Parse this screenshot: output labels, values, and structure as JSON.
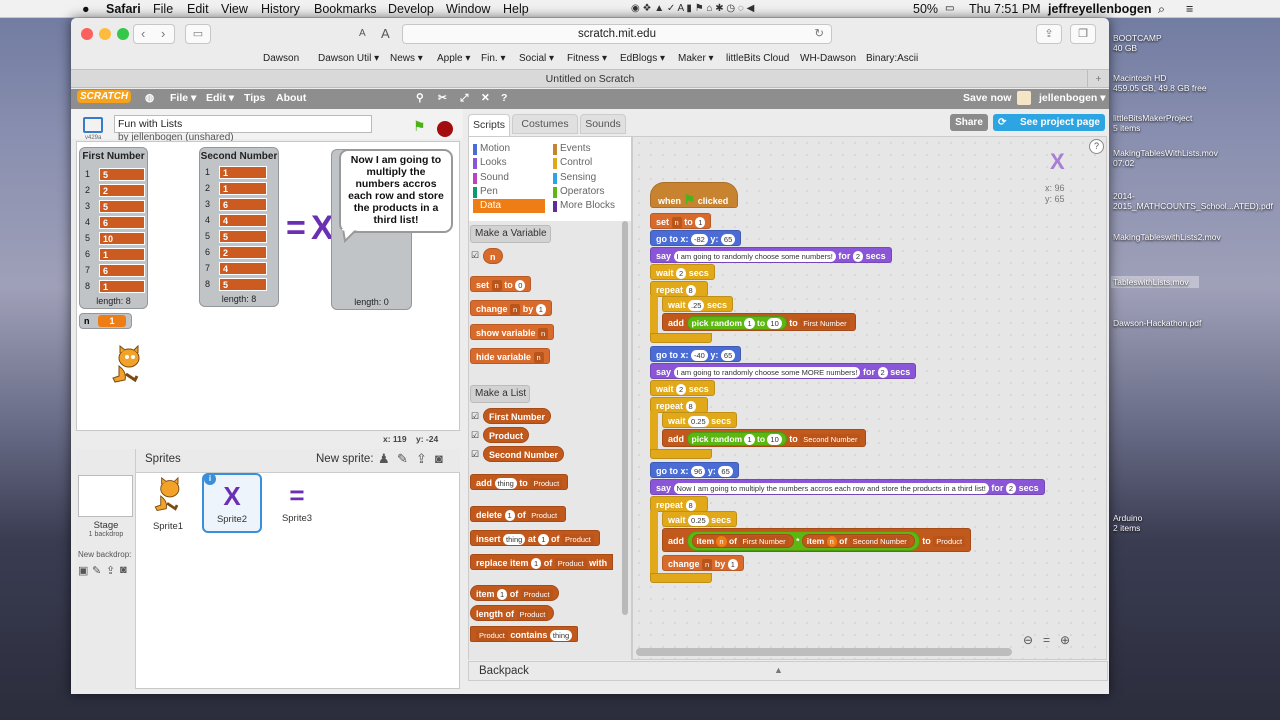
{
  "menubar": {
    "app": "Safari",
    "items": [
      "File",
      "Edit",
      "View",
      "History",
      "Bookmarks",
      "Develop",
      "Window",
      "Help"
    ],
    "battery": "50%",
    "clock": "Thu 7:51 PM",
    "user": "jeffreyellenbogen"
  },
  "desktop": [
    {
      "name": "BOOTCAMP",
      "sub": "40 GB"
    },
    {
      "name": "Macintosh HD",
      "sub": "459.05 GB, 49.8 GB free"
    },
    {
      "name": "littleBitsMakerProject",
      "sub": "5 items"
    },
    {
      "name": "MakingTablesWithLists.mov",
      "sub": "07:02"
    },
    {
      "name": "2014-2015_MATHCOUNTS_School...ATED).pdf",
      "sub": ""
    },
    {
      "name": "MakingTableswithLists2.mov",
      "sub": ""
    },
    {
      "name": "TableswithLists.mov",
      "sub": ""
    },
    {
      "name": "Dawson-Hackathon.pdf",
      "sub": ""
    },
    {
      "name": "Arduino",
      "sub": "2 items"
    }
  ],
  "browser": {
    "url": "scratch.mit.edu",
    "tab_title": "Untitled on Scratch",
    "font_small": "A",
    "font_large": "A",
    "favorites": [
      "Dawson",
      "Dawson Util ▾",
      "News ▾",
      "Apple ▾",
      "Fin. ▾",
      "Social ▾",
      "Fitness ▾",
      "EdBlogs ▾",
      "Maker ▾",
      "littleBits Cloud",
      "WH-Dawson",
      "Binary:Ascii"
    ]
  },
  "scratch": {
    "logo": "SCRATCH",
    "menu": [
      "File ▾",
      "Edit ▾",
      "Tips",
      "About"
    ],
    "save": "Save now",
    "user": "jellenbogen ▾",
    "share": "Share",
    "see_project": "See project page",
    "project_title": "Fun with Lists",
    "byline": "by jellenbogen (unshared)",
    "version": "v429a",
    "tabs": [
      "Scripts",
      "Costumes",
      "Sounds"
    ],
    "categories_left": [
      "Motion",
      "Looks",
      "Sound",
      "Pen",
      "Data"
    ],
    "categories_right": [
      "Events",
      "Control",
      "Sensing",
      "Operators",
      "More Blocks"
    ],
    "cat_colors": [
      "#4a6cd4",
      "#8a55d7",
      "#bb42c3",
      "#0e9a6c",
      "#ee7d16",
      "#c88330",
      "#e1a91a",
      "#2ca5e2",
      "#5cb712",
      "#632d99"
    ],
    "make_variable": "Make a Variable",
    "make_list": "Make a List",
    "var_name": "n",
    "lists": [
      "First Number",
      "Product",
      "Second Number"
    ],
    "palette": {
      "set": "set",
      "n": "n",
      "to": "to",
      "zero": "0",
      "change": "change",
      "by": "by",
      "one": "1",
      "show": "show variable",
      "hide": "hide variable",
      "add": "add",
      "thing": "thing",
      "product": "Product",
      "delete": "delete",
      "of": "of",
      "insert": "insert",
      "at": "at",
      "replace": "replace item",
      "with": "with",
      "item": "item",
      "length": "length of",
      "contains": "contains"
    },
    "monitors": {
      "first": {
        "title": "First Number",
        "values": [
          "5",
          "2",
          "5",
          "6",
          "10",
          "1",
          "6",
          "1"
        ],
        "length": "length: 8"
      },
      "second": {
        "title": "Second Number",
        "values": [
          "1",
          "1",
          "6",
          "4",
          "5",
          "2",
          "4",
          "5"
        ],
        "length": "length: 8"
      },
      "product": {
        "length": "length: 0"
      },
      "n_label": "n",
      "n_value": "1"
    },
    "speech": "Now I am going to multiply the numbers accros each row and store the products in a third list!",
    "coords_stage": {
      "x": "x: 119",
      "y": "y: -24"
    },
    "sprite_x": "X",
    "sprite_coords": {
      "x": "x: 96",
      "y": "y: 65"
    },
    "sprites_label": "Sprites",
    "new_sprite": "New sprite:",
    "stage_label": "Stage",
    "stage_sub": "1 backdrop",
    "new_backdrop": "New backdrop:",
    "sprites": [
      "Sprite1",
      "Sprite2",
      "Sprite3"
    ],
    "sprite3_glyph": "=",
    "backpack": "Backpack",
    "script": {
      "when": "when",
      "clicked": "clicked",
      "set": "set",
      "to": "to",
      "go": "go to x:",
      "y": "y:",
      "say": "say",
      "for": "for",
      "secs": "secs",
      "wait": "wait",
      "repeat": "repeat",
      "add": "add",
      "pick": "pick random",
      "change": "change",
      "by": "by",
      "item": "item",
      "of": "of",
      "n": "n",
      "one": "1",
      "two": "2",
      "eight": "8",
      "gx1": "-82",
      "gy1": "65",
      "gx2": "-40",
      "gy2": "65",
      "gx3": "96",
      "gy3": "65",
      "w1": ".25",
      "w2": "0.25",
      "w3": "0.25",
      "ten": "10",
      "say1": "I am going to randomly choose some numbers!",
      "say2": "I am going to randomly choose some MORE numbers!",
      "say3": "Now I am going to multiply the numbers accros each row and store the products in a third list!",
      "list1": "First Number",
      "list2": "Second Number",
      "list3": "Product",
      "times": "*"
    }
  }
}
